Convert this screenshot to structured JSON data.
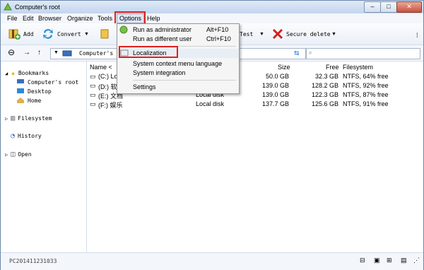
{
  "window": {
    "title": "Computer's root"
  },
  "menubar": [
    "File",
    "Edit",
    "Browser",
    "Organize",
    "Tools",
    "Options",
    "Help"
  ],
  "toolbar": {
    "add": "Add",
    "convert": "Convert",
    "test": "Test",
    "secure_delete": "Secure delete"
  },
  "address": {
    "path": "Computer's ro"
  },
  "sidebar": {
    "bookmarks": "Bookmarks",
    "computers_root": "Computer's root",
    "desktop": "Desktop",
    "home": "Home",
    "filesystem": "Filesystem",
    "history": "History",
    "open": "Open"
  },
  "columns": {
    "name": "Name <",
    "size": "Size",
    "free": "Free",
    "filesystem": "Filesystem"
  },
  "rows": [
    {
      "name": "(C:) Lo",
      "type": "",
      "size": "50.0 GB",
      "free": "32.3 GB",
      "fs": "NTFS, 64% free"
    },
    {
      "name": "(D:) 软",
      "type": "",
      "size": "139.0 GB",
      "free": "128.2 GB",
      "fs": "NTFS, 92% free"
    },
    {
      "name": "(E:) 文档",
      "type": "Local disk",
      "size": "139.0 GB",
      "free": "122.3 GB",
      "fs": "NTFS, 87% free"
    },
    {
      "name": "(F:) 娱乐",
      "type": "Local disk",
      "size": "137.7 GB",
      "free": "125.6 GB",
      "fs": "NTFS, 91% free"
    }
  ],
  "options_menu": {
    "run_as_admin": "Run as administrator",
    "run_as_admin_shortcut": "Alt+F10",
    "run_as_different": "Run as different user",
    "run_as_different_shortcut": "Ctrl+F10",
    "localization": "Localization",
    "context_language": "System context menu language",
    "system_integration": "System integration",
    "settings": "Settings"
  },
  "status": {
    "text": "PC201411231033"
  },
  "colors": {
    "highlight": "#e0201c",
    "accent": "#1f6fd1"
  }
}
